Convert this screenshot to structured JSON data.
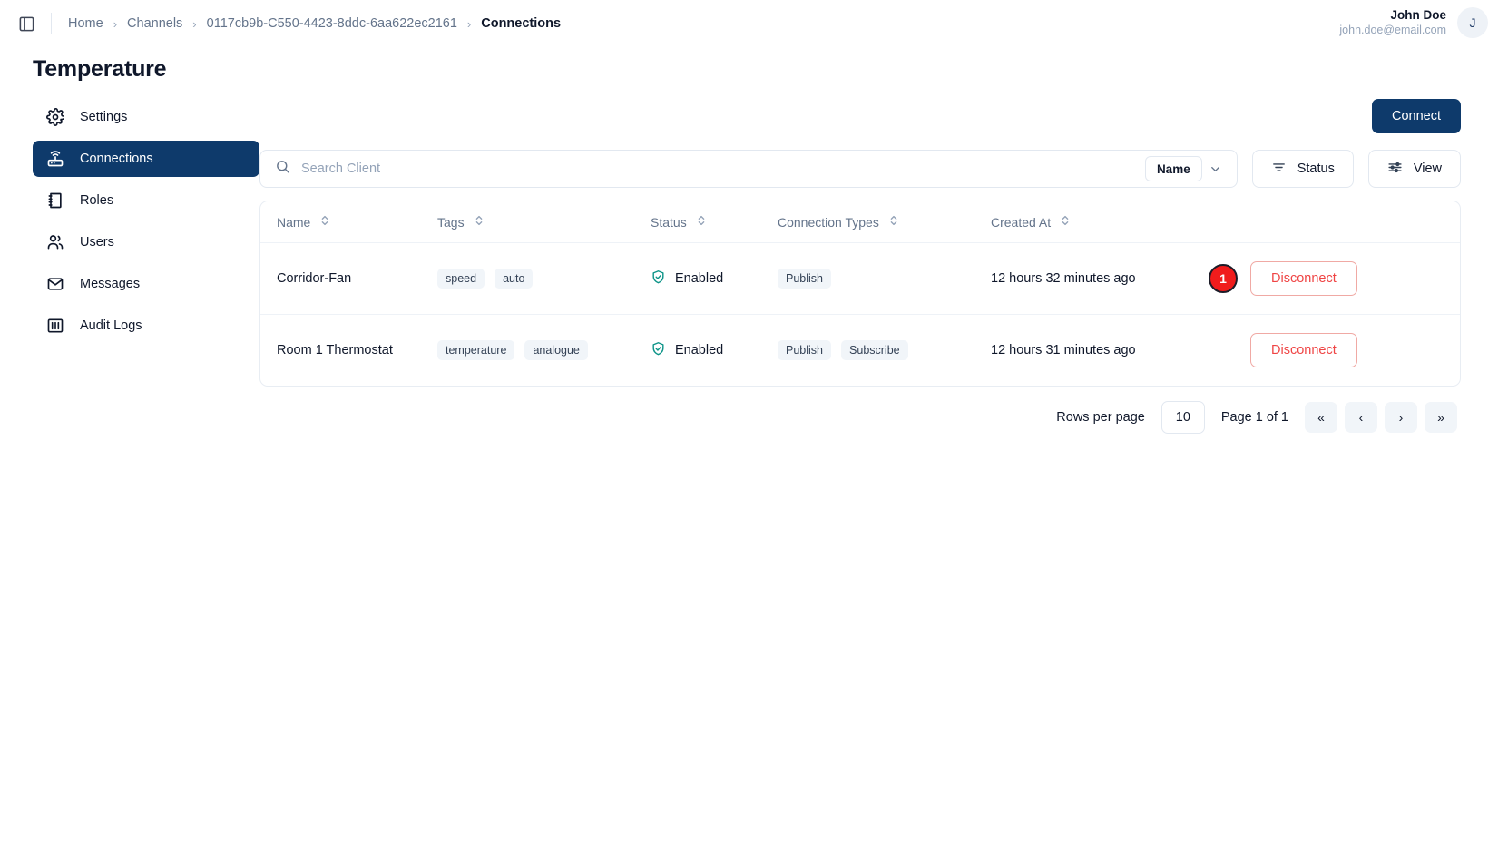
{
  "topbar": {
    "panel_toggle_icon": "sidebar-toggle-icon",
    "breadcrumb": [
      {
        "label": "Home",
        "current": false
      },
      {
        "label": "Channels",
        "current": false
      },
      {
        "label": "0117cb9b-C550-4423-8ddc-6aa622ec2161",
        "current": false
      },
      {
        "label": "Connections",
        "current": true
      }
    ],
    "separator": "›",
    "user": {
      "name": "John Doe",
      "email": "john.doe@email.com",
      "avatar_initial": "J"
    }
  },
  "page": {
    "title": "Temperature"
  },
  "sidebar": {
    "items": [
      {
        "label": "Settings",
        "icon": "gear-icon",
        "active": false
      },
      {
        "label": "Connections",
        "icon": "router-icon",
        "active": true
      },
      {
        "label": "Roles",
        "icon": "book-icon",
        "active": false
      },
      {
        "label": "Users",
        "icon": "users-icon",
        "active": false
      },
      {
        "label": "Messages",
        "icon": "mail-icon",
        "active": false
      },
      {
        "label": "Audit Logs",
        "icon": "logs-icon",
        "active": false
      }
    ]
  },
  "toolbar": {
    "connect_label": "Connect",
    "search_placeholder": "Search Client",
    "search_value": "",
    "search_icon": "search-icon",
    "filter_chip_label": "Name",
    "chevron_icon": "chevron-down-icon",
    "status_button_label": "Status",
    "status_icon": "filter-icon",
    "view_button_label": "View",
    "view_icon": "sliders-icon"
  },
  "table": {
    "columns": [
      {
        "label": "Name",
        "sortable": true
      },
      {
        "label": "Tags",
        "sortable": true
      },
      {
        "label": "Status",
        "sortable": true
      },
      {
        "label": "Connection Types",
        "sortable": true
      },
      {
        "label": "Created At",
        "sortable": true
      },
      {
        "label": "",
        "sortable": false
      }
    ],
    "rows": [
      {
        "name": "Corridor-Fan",
        "tags": [
          "speed",
          "auto"
        ],
        "status": "Enabled",
        "connection_types": [
          "Publish"
        ],
        "created_at": "12 hours 32 minutes ago",
        "action_label": "Disconnect",
        "marker": "1"
      },
      {
        "name": "Room 1 Thermostat",
        "tags": [
          "temperature",
          "analogue"
        ],
        "status": "Enabled",
        "connection_types": [
          "Publish",
          "Subscribe"
        ],
        "created_at": "12 hours 31 minutes ago",
        "action_label": "Disconnect",
        "marker": null
      }
    ]
  },
  "pagination": {
    "rows_per_page_label": "Rows per page",
    "rows_per_page_value": "10",
    "page_info": "Page 1 of 1",
    "first_label": "«",
    "prev_label": "‹",
    "next_label": "›",
    "last_label": "»"
  },
  "colors": {
    "brand": "#0e3a6b",
    "danger": "#ef4444",
    "status_ok": "#0d9488",
    "marker": "#f01c1c"
  }
}
